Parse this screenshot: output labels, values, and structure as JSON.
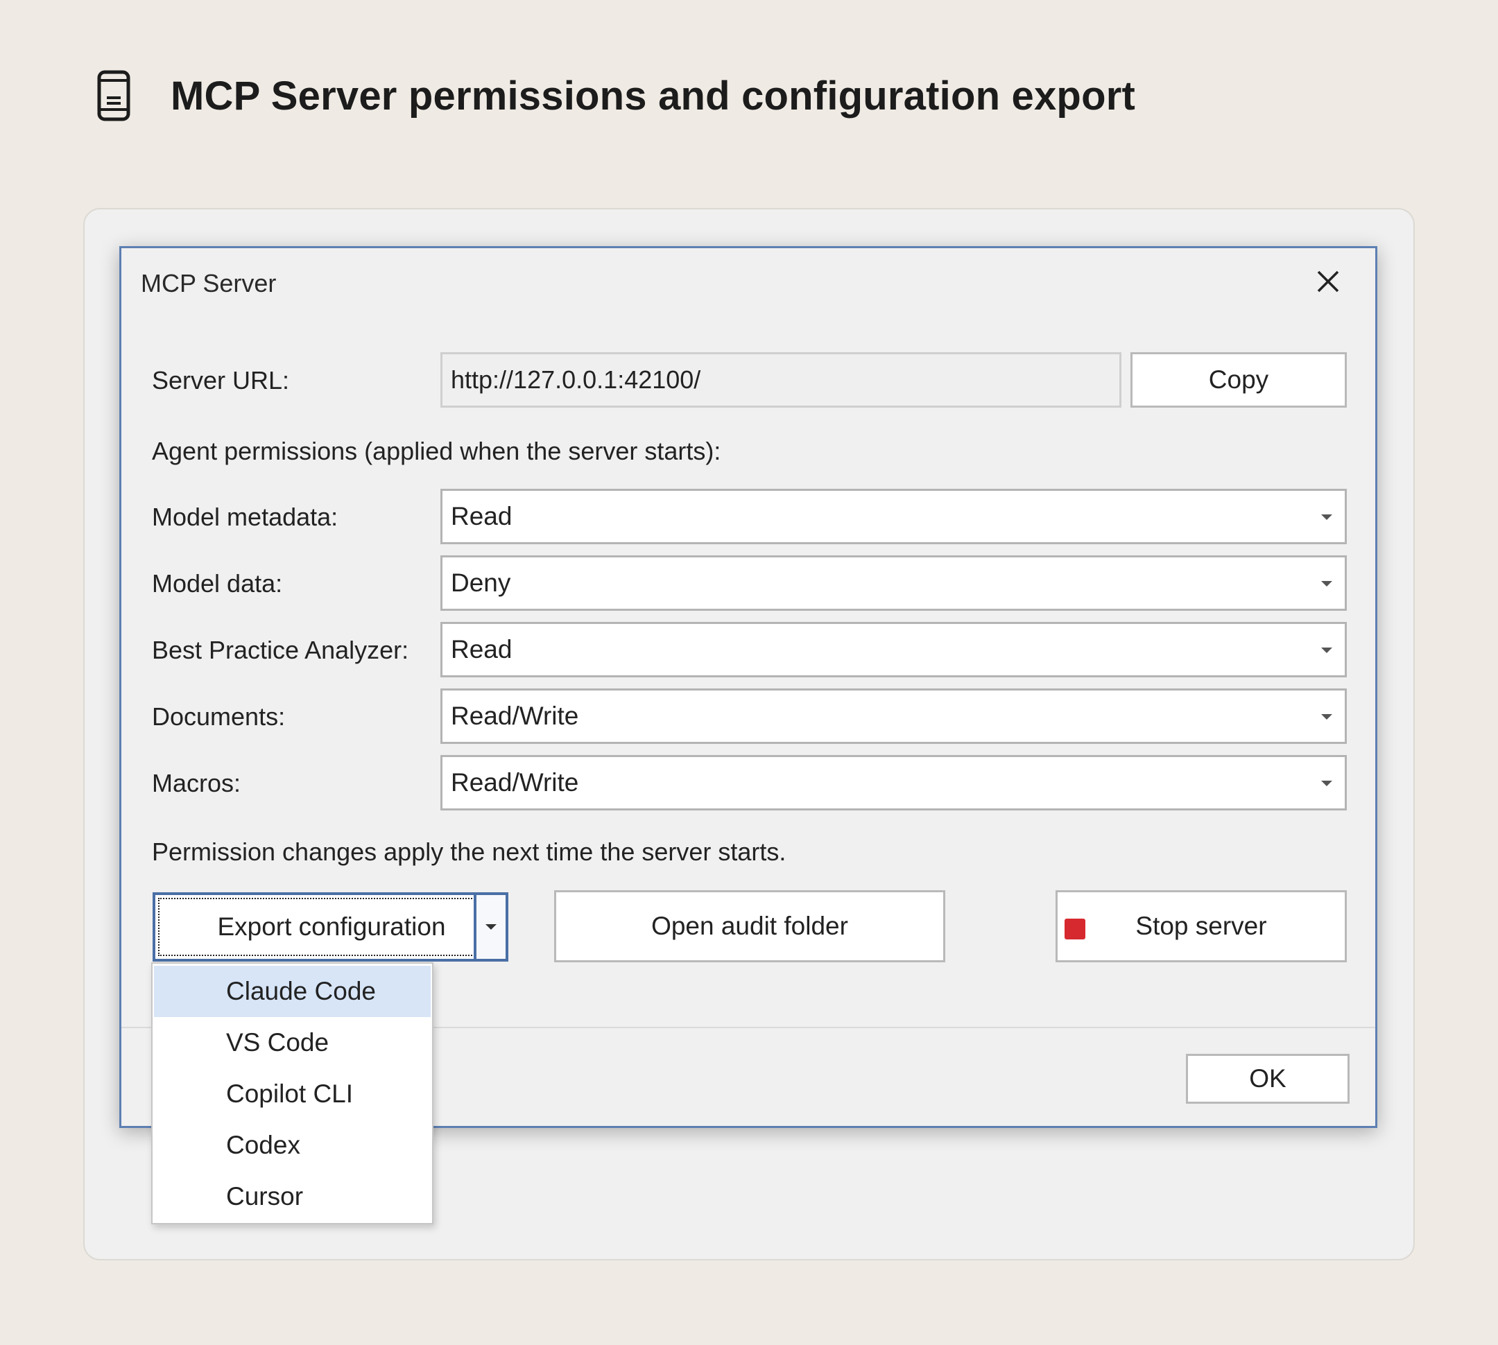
{
  "header": {
    "title": "MCP Server permissions and configuration export",
    "icon": "mobile-device-icon"
  },
  "dialog": {
    "title": "MCP Server",
    "close_icon": "close-icon",
    "server_url": {
      "label": "Server URL:",
      "value": "http://127.0.0.1:42100/",
      "copy_label": "Copy"
    },
    "permissions_heading": "Agent permissions (applied when the server starts):",
    "permissions": [
      {
        "label": "Model metadata:",
        "value": "Read"
      },
      {
        "label": "Model data:",
        "value": "Deny"
      },
      {
        "label": "Best Practice Analyzer:",
        "value": "Read"
      },
      {
        "label": "Documents:",
        "value": "Read/Write"
      },
      {
        "label": "Macros:",
        "value": "Read/Write"
      }
    ],
    "note": "Permission changes apply the next time the server starts.",
    "buttons": {
      "export": "Export configuration",
      "audit": "Open audit folder",
      "stop": "Stop server",
      "ok": "OK"
    },
    "stop_icon_color": "#d6292f",
    "accent_color": "#4a6fa5"
  },
  "export_menu": {
    "items": [
      {
        "label": "Claude Code",
        "selected": true
      },
      {
        "label": "VS Code"
      },
      {
        "label": "Copilot CLI"
      },
      {
        "label": "Codex"
      },
      {
        "label": "Cursor"
      }
    ]
  }
}
